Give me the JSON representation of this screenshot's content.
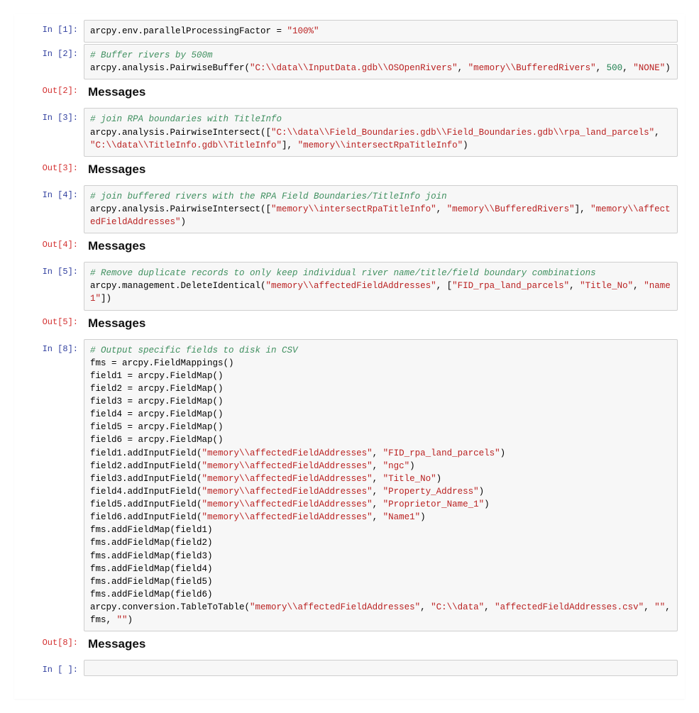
{
  "cells": [
    {
      "in_label": "In [1]:",
      "code": "arcpy.env.parallelProcessingFactor = <span class='str'>\"100%\"</span>"
    },
    {
      "in_label": "In [2]:",
      "code": "<span class='cmt'># Buffer rivers by 500m</span>\narcpy.analysis.PairwiseBuffer(<span class='str'>\"C:\\\\data\\\\InputData.gdb\\\\OSOpenRivers\"</span>, <span class='str'>\"memory\\\\BufferedRivers\"</span>, <span class='num'>500</span>, <span class='str'>\"NONE\"</span>)",
      "out_label": "Out[2]:",
      "out_heading": "Messages"
    },
    {
      "in_label": "In [3]:",
      "code": "<span class='cmt'># join RPA boundaries with TitleInfo</span>\narcpy.analysis.PairwiseIntersect([<span class='str'>\"C:\\\\data\\\\Field_Boundaries.gdb\\\\Field_Boundaries.gdb\\\\rpa_land_parcels\"</span>, <span class='str'>\"C:\\\\data\\\\TitleInfo.gdb\\\\TitleInfo\"</span>], <span class='str'>\"memory\\\\intersectRpaTitleInfo\"</span>)",
      "out_label": "Out[3]:",
      "out_heading": "Messages"
    },
    {
      "in_label": "In [4]:",
      "code": "<span class='cmt'># join buffered rivers with the RPA Field Boundaries/TitleInfo join</span>\narcpy.analysis.PairwiseIntersect([<span class='str'>\"memory\\\\intersectRpaTitleInfo\"</span>, <span class='str'>\"memory\\\\BufferedRivers\"</span>], <span class='str'>\"memory\\\\affectedFieldAddresses\"</span>)",
      "out_label": "Out[4]:",
      "out_heading": "Messages"
    },
    {
      "in_label": "In [5]:",
      "code": "<span class='cmt'># Remove duplicate records to only keep individual river name/title/field boundary combinations</span>\narcpy.management.DeleteIdentical(<span class='str'>\"memory\\\\affectedFieldAddresses\"</span>, [<span class='str'>\"FID_rpa_land_parcels\"</span>, <span class='str'>\"Title_No\"</span>, <span class='str'>\"name1\"</span>])",
      "out_label": "Out[5]:",
      "out_heading": "Messages"
    },
    {
      "in_label": "In [8]:",
      "code": "<span class='cmt'># Output specific fields to disk in CSV</span>\nfms = arcpy.FieldMappings()\nfield1 = arcpy.FieldMap()\nfield2 = arcpy.FieldMap()\nfield3 = arcpy.FieldMap()\nfield4 = arcpy.FieldMap()\nfield5 = arcpy.FieldMap()\nfield6 = arcpy.FieldMap()\nfield1.addInputField(<span class='str'>\"memory\\\\affectedFieldAddresses\"</span>, <span class='str'>\"FID_rpa_land_parcels\"</span>)\nfield2.addInputField(<span class='str'>\"memory\\\\affectedFieldAddresses\"</span>, <span class='str'>\"ngc\"</span>)\nfield3.addInputField(<span class='str'>\"memory\\\\affectedFieldAddresses\"</span>, <span class='str'>\"Title_No\"</span>)\nfield4.addInputField(<span class='str'>\"memory\\\\affectedFieldAddresses\"</span>, <span class='str'>\"Property_Address\"</span>)\nfield5.addInputField(<span class='str'>\"memory\\\\affectedFieldAddresses\"</span>, <span class='str'>\"Proprietor_Name_1\"</span>)\nfield6.addInputField(<span class='str'>\"memory\\\\affectedFieldAddresses\"</span>, <span class='str'>\"Name1\"</span>)\nfms.addFieldMap(field1)\nfms.addFieldMap(field2)\nfms.addFieldMap(field3)\nfms.addFieldMap(field4)\nfms.addFieldMap(field5)\nfms.addFieldMap(field6)\narcpy.conversion.TableToTable(<span class='str'>\"memory\\\\affectedFieldAddresses\"</span>, <span class='str'>\"C:\\\\data\"</span>, <span class='str'>\"affectedFieldAddresses.csv\"</span>, <span class='str'>\"\"</span>, fms, <span class='str'>\"\"</span>)",
      "out_label": "Out[8]:",
      "out_heading": "Messages"
    },
    {
      "in_label": "In [ ]:",
      "code": ""
    }
  ]
}
